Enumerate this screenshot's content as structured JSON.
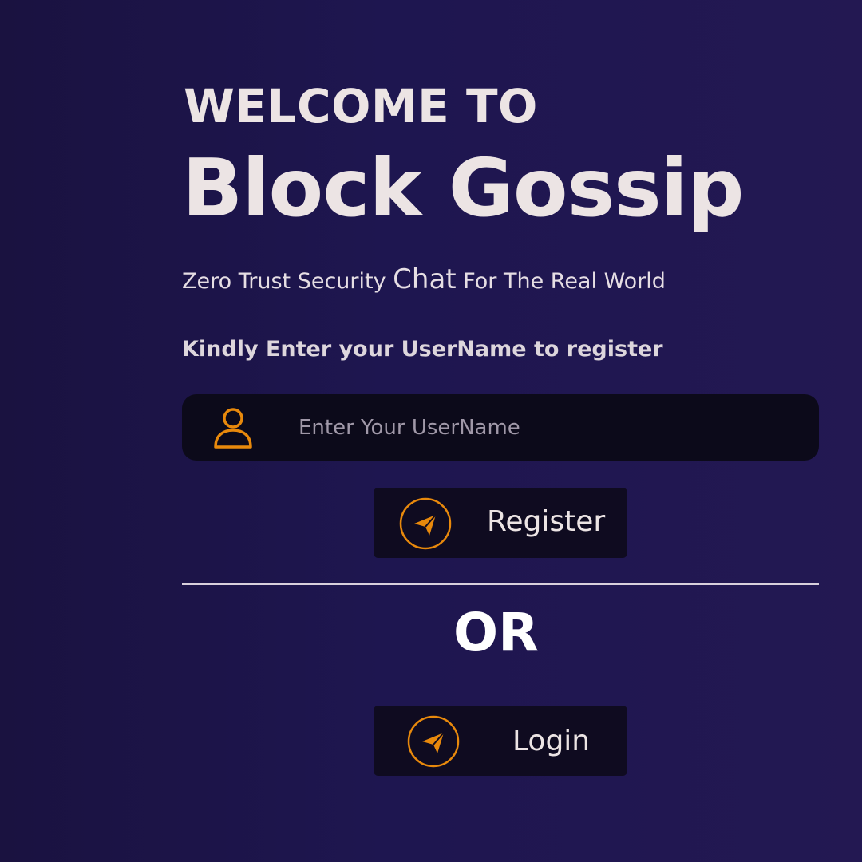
{
  "header": {
    "welcome": "WELCOME TO",
    "brand": "Block Gossip"
  },
  "tagline": {
    "part1": "Zero Trust Security ",
    "emphasis": "Chat",
    "part2": " For The Real World"
  },
  "form": {
    "prompt": "Kindly Enter your UserName to register",
    "username_placeholder": "Enter Your UserName",
    "username_value": "",
    "register_label": "Register",
    "or_label": "OR",
    "login_label": "Login"
  },
  "icons": {
    "user": "user-icon",
    "send": "send-icon"
  },
  "colors": {
    "background": "#1e1650",
    "accent": "#e8890c",
    "field_bg": "#0c0a1a",
    "text": "#ece4e4"
  }
}
